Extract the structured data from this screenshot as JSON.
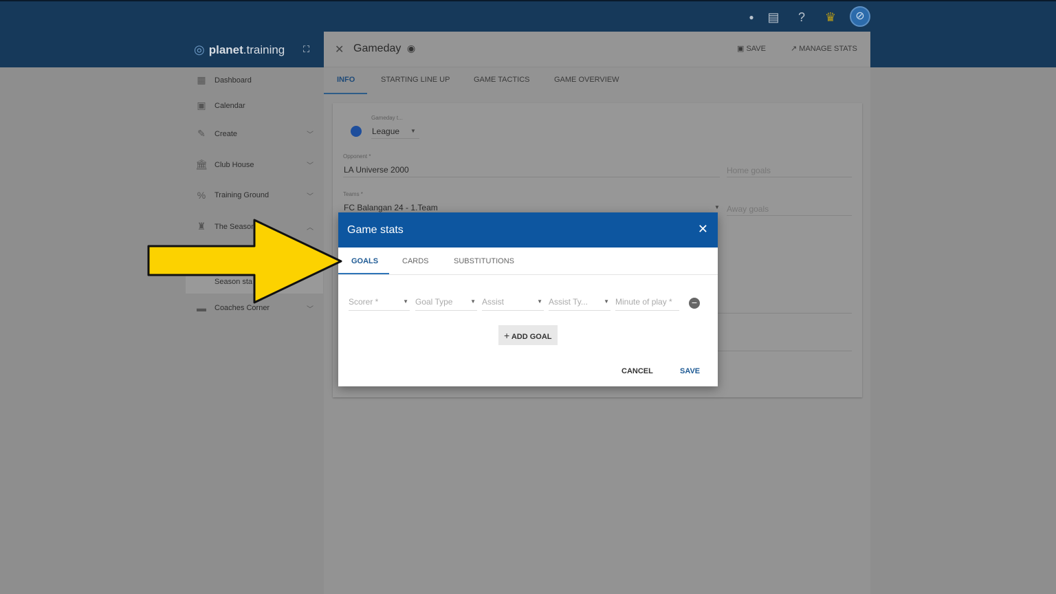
{
  "topbar": {
    "icons": [
      "dot-icon",
      "chat-icon",
      "help-icon",
      "trophy-icon",
      "avatar-icon"
    ]
  },
  "brand": {
    "name_bold": "planet",
    "name_rest": ".training"
  },
  "sidebar": {
    "items": [
      {
        "label": "Dashboard",
        "icon": "dashboard-icon"
      },
      {
        "label": "Calendar",
        "icon": "calendar-icon"
      },
      {
        "label": "Create",
        "icon": "pencil-icon"
      },
      {
        "label": "Club House",
        "icon": "bank-icon"
      },
      {
        "label": "Training Ground",
        "icon": "percent-icon"
      },
      {
        "label": "The Season",
        "icon": "trophy-icon"
      },
      {
        "label": "Season sta",
        "icon": ""
      },
      {
        "label": "Coaches Corner",
        "icon": "sofa-icon"
      }
    ]
  },
  "page": {
    "title": "Gameday",
    "save": "SAVE",
    "manage_stats": "MANAGE STATS",
    "tabs": [
      "INFO",
      "STARTING LINE UP",
      "GAME TACTICS",
      "GAME OVERVIEW"
    ]
  },
  "form": {
    "gameday_type_label": "Gameday t...",
    "gameday_type": "League",
    "type_color": "#1e4e9c",
    "opponent_label": "Opponent *",
    "opponent": "LA Universe 2000",
    "home_goals": "Home goals",
    "teams_label": "Teams *",
    "teams": "FC Balangan 24 - 1.Team",
    "away_goals": "Away goals"
  },
  "dialog": {
    "title": "Game stats",
    "tabs": [
      "GOALS",
      "CARDS",
      "SUBSTITUTIONS"
    ],
    "fields": [
      "Scorer *",
      "Goal Type",
      "Assist",
      "Assist Ty...",
      "Minute of play *"
    ],
    "add_goal": "ADD GOAL",
    "cancel": "CANCEL",
    "save": "SAVE",
    "accent": "#0d56a0"
  }
}
